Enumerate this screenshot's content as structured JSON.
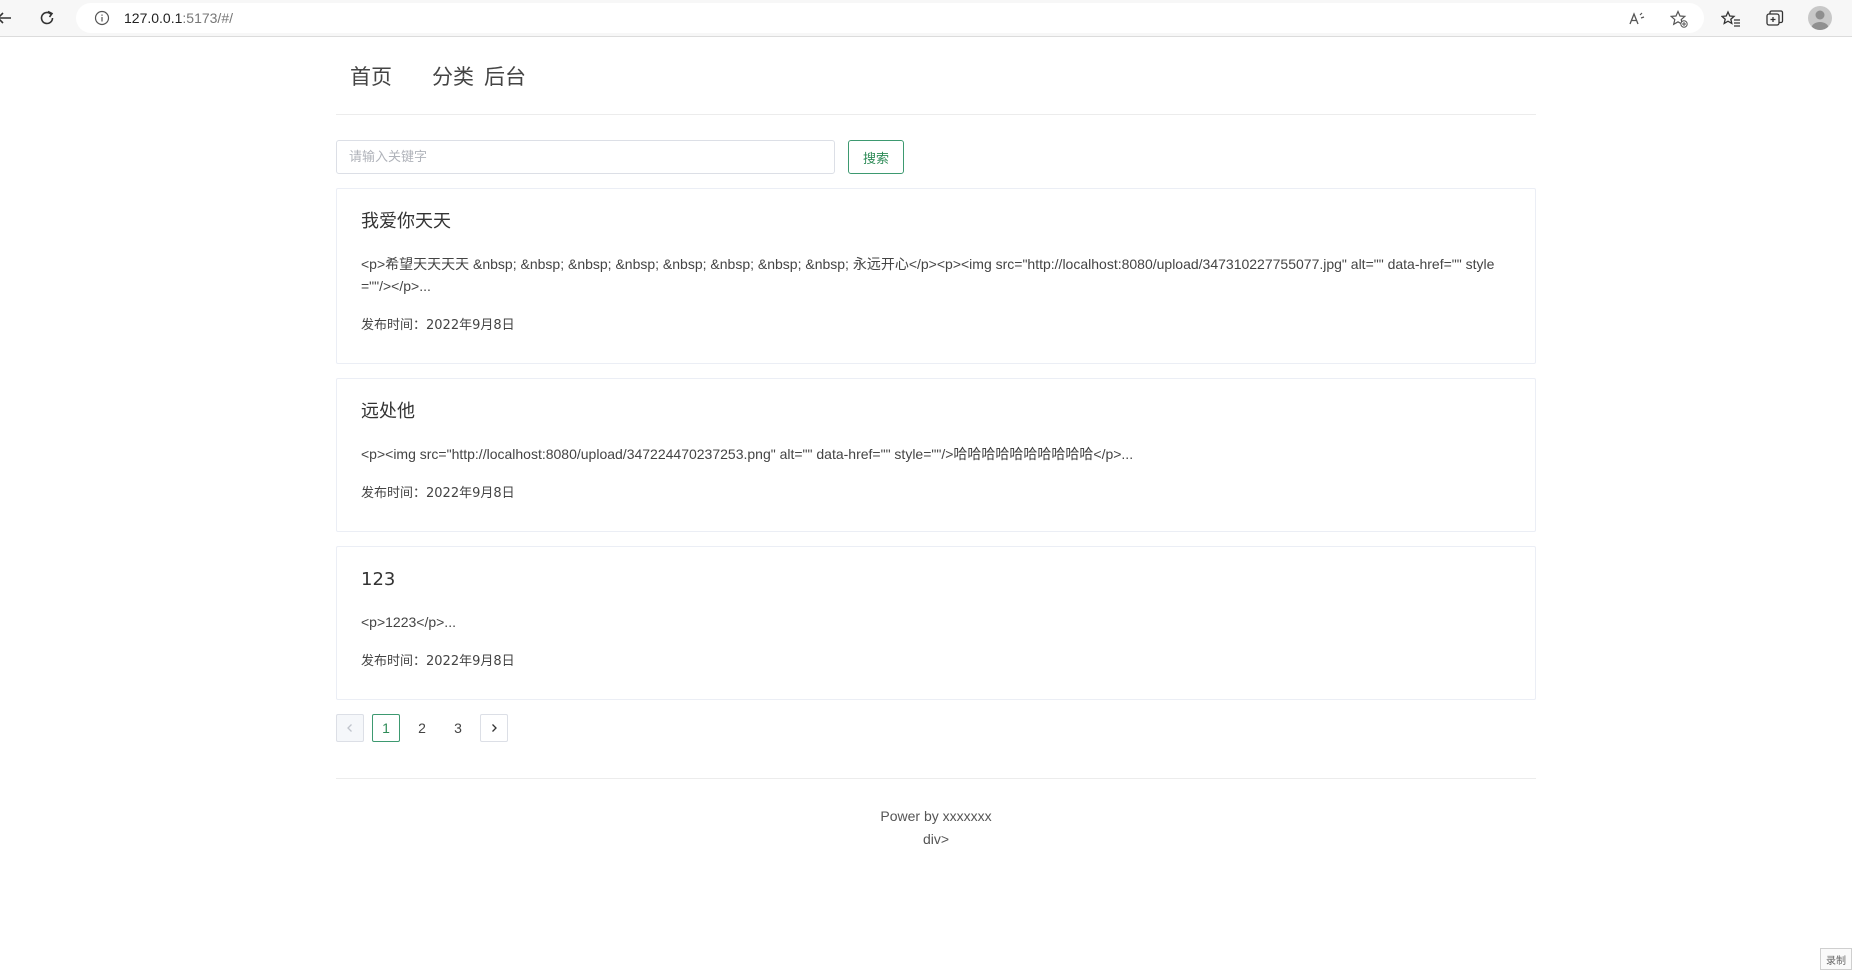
{
  "browser": {
    "url_host": "127.0.0.1",
    "url_path": ":5173/#/",
    "icons": [
      "back-icon",
      "refresh-icon",
      "info-icon",
      "read-aloud-icon",
      "add-favorite-icon",
      "favorites-icon",
      "collections-icon",
      "profile-icon"
    ]
  },
  "nav": {
    "home": "首页",
    "category": "分类",
    "admin": "后台"
  },
  "search": {
    "placeholder": "请输入关键字",
    "button": "搜索"
  },
  "posts": [
    {
      "title": "我爱你天天",
      "excerpt": "<p>希望天天天天 &nbsp; &nbsp; &nbsp; &nbsp; &nbsp; &nbsp; &nbsp; &nbsp; 永远开心</p><p><img src=\"http://localhost:8080/upload/347310227755077.jpg\" alt=\"\" data-href=\"\" style=\"\"/></p>...",
      "date": "发布时间：2022年9月8日"
    },
    {
      "title": "远处他",
      "excerpt": "<p><img src=\"http://localhost:8080/upload/347224470237253.png\" alt=\"\" data-href=\"\" style=\"\"/>哈哈哈哈哈哈哈哈哈哈</p>...",
      "date": "发布时间：2022年9月8日"
    },
    {
      "title": "123",
      "excerpt": "<p>1223</p>...",
      "date": "发布时间：2022年9月8日"
    }
  ],
  "pagination": {
    "pages": [
      "1",
      "2",
      "3"
    ],
    "current": "1"
  },
  "footer": {
    "line1": "Power by xxxxxxx",
    "line2": "div>"
  },
  "corner_badge": "录制",
  "colors": {
    "accent": "#2e8b57",
    "border": "#ebeef5"
  }
}
